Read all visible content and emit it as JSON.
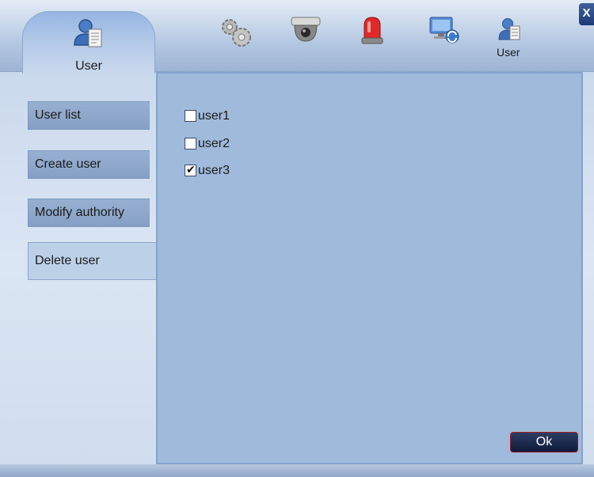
{
  "header": {
    "active_tab_label": "User",
    "toolbar_user_label": "User",
    "close_label": "X",
    "icons": [
      "user-icon",
      "gears-icon",
      "camera-icon",
      "alarm-icon",
      "network-icon",
      "user-icon"
    ]
  },
  "sidebar": {
    "items": [
      {
        "label": "User list"
      },
      {
        "label": "Create user"
      },
      {
        "label": "Modify authority"
      },
      {
        "label": "Delete user",
        "active": true
      }
    ]
  },
  "users": [
    {
      "name": "user1",
      "checked": false
    },
    {
      "name": "user2",
      "checked": false
    },
    {
      "name": "user3",
      "checked": true
    }
  ],
  "buttons": {
    "ok_label": "Ok"
  },
  "colors": {
    "accent": "#1e3b78",
    "panel": "#9fbadb",
    "ok_border": "#a0182a"
  }
}
